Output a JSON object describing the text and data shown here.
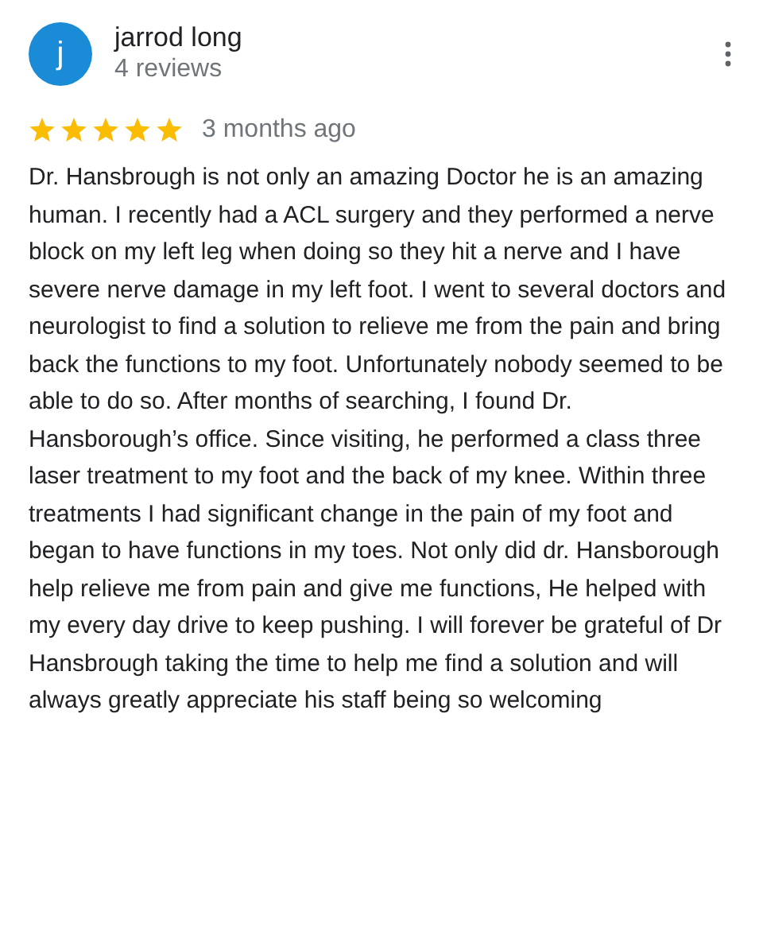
{
  "reviewer": {
    "initial": "j",
    "name": "jarrod long",
    "reviews": "4 reviews"
  },
  "review": {
    "stars": 5,
    "time": "3 months ago",
    "text": "Dr. Hansbrough is not only an amazing Doctor he is an amazing human. I recently had a ACL surgery and they performed a nerve block on my left leg when doing so they hit a nerve and I have severe nerve damage in my left foot. I went to several doctors and neurologist to find a solution to relieve me from the pain and bring back the functions to my foot. Unfortunately nobody seemed to be able to do so. After months of searching, I found Dr. Hansborough’s office. Since visiting, he performed a class three laser treatment to my foot and the back of my knee. Within three treatments I had significant change in the pain of my foot and began to have functions in my toes. Not only did dr. Hansborough help relieve me from pain and give me functions, He helped with my every day drive to keep pushing. I will forever be grateful of Dr Hansbrough taking the time to help me find a solution and will always greatly appreciate his staff being so welcoming"
  }
}
